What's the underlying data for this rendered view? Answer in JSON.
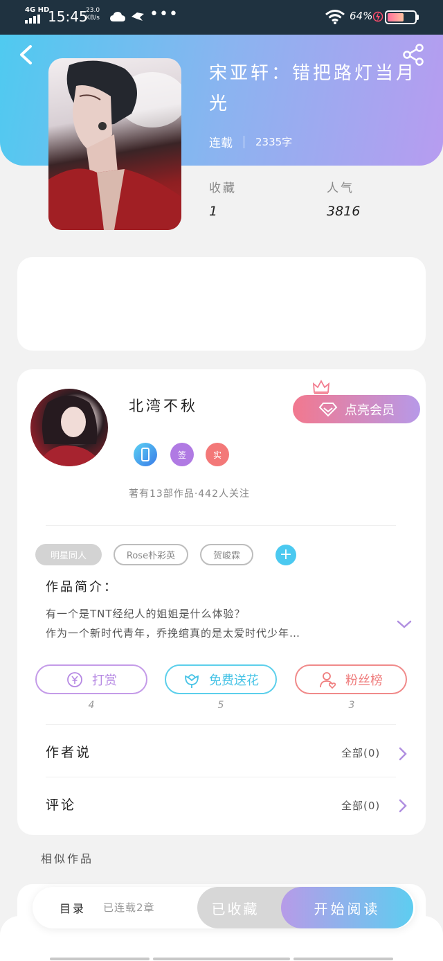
{
  "status_bar": {
    "network": "4G HD",
    "time": "15:45",
    "speed_value": "23.0",
    "speed_unit": "KB/s",
    "battery_percent": "64%"
  },
  "book": {
    "title": "宋亚轩：错把路灯当月光",
    "status": "连载",
    "word_count": "2335字",
    "collect_label": "收藏",
    "collect_value": "1",
    "popularity_label": "人气",
    "popularity_value": "3816"
  },
  "author": {
    "name": "北湾不秋",
    "badges": [
      "签",
      "实"
    ],
    "stats": "著有13部作品·442人关注",
    "vip_button": "点亮会员"
  },
  "tags": [
    "明星同人",
    "Rose朴彩英",
    "贺峻霖"
  ],
  "intro": {
    "title": "作品简介：",
    "line1": "有一个是TNT经纪人的姐姐是什么体验？",
    "line2": "作为一个新时代青年，乔挽绾真的是太爱时代少年…"
  },
  "actions": [
    {
      "label": "打赏",
      "count": "4"
    },
    {
      "label": "免费送花",
      "count": "5"
    },
    {
      "label": "粉丝榜",
      "count": "3"
    }
  ],
  "rows": {
    "author_says_label": "作者说",
    "author_says_right": "全部(0)",
    "comments_label": "评论",
    "comments_right": "全部(0)"
  },
  "similar_label": "相似作品",
  "bottom_bar": {
    "catalog": "目录",
    "serial": "已连载2章",
    "collected": "已收藏",
    "read": "开始阅读"
  },
  "colors": {
    "hero_start": "#4fcaf0",
    "hero_end": "#b79cf0",
    "accent_blue": "#4bc9f0",
    "accent_purple": "#b689e3",
    "accent_red": "#ef7d7d"
  },
  "icons": [
    "back-icon",
    "share-icon",
    "crown-icon",
    "gem-icon",
    "yen-icon",
    "flower-icon",
    "fans-icon",
    "chevron-down-icon",
    "chevron-right-icon",
    "plus-icon"
  ]
}
